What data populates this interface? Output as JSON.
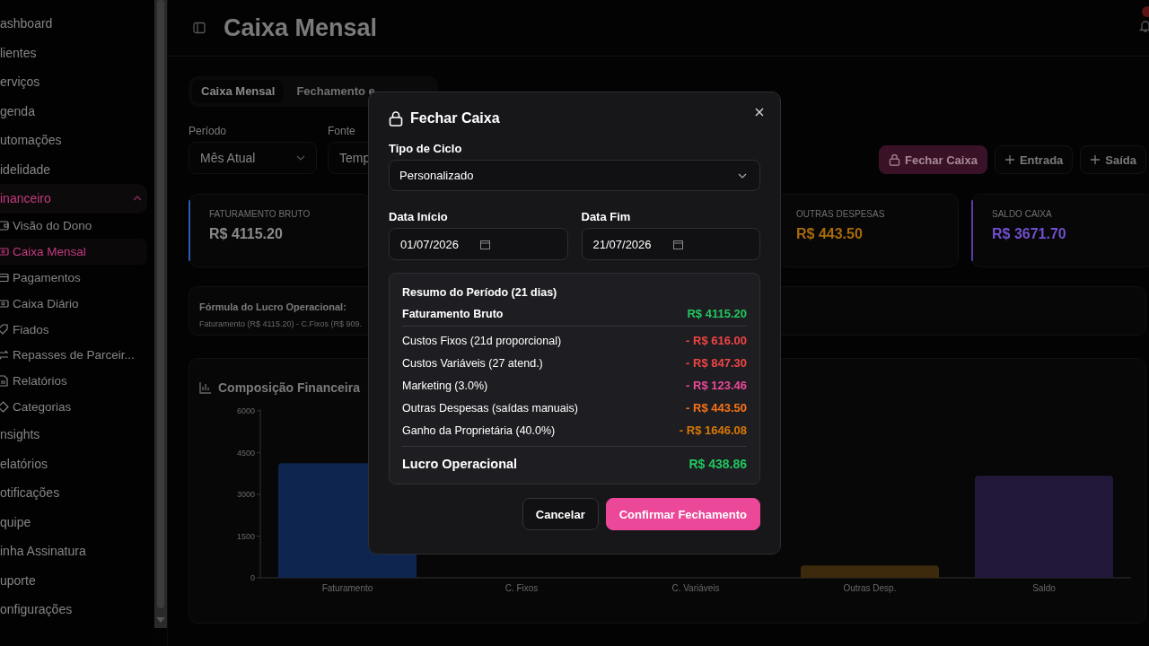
{
  "sidebar": {
    "items": [
      {
        "label": "ashboard",
        "selected": false
      },
      {
        "label": "lientes",
        "selected": false
      },
      {
        "label": "erviços",
        "selected": false
      },
      {
        "label": "genda",
        "selected": false
      },
      {
        "label": "utomações",
        "selected": false
      },
      {
        "label": "idelidade",
        "selected": false
      },
      {
        "label": "inanceiro",
        "selected": true,
        "expanded": true,
        "children": [
          {
            "label": "Visão do Dono",
            "selected": false
          },
          {
            "label": "Caixa Mensal",
            "selected": true
          },
          {
            "label": "Pagamentos",
            "selected": false
          },
          {
            "label": "Caixa Diário",
            "selected": false
          },
          {
            "label": "Fiados",
            "selected": false
          },
          {
            "label": "Repasses de Parceir...",
            "selected": false
          },
          {
            "label": "Relatórios",
            "selected": false
          },
          {
            "label": "Categorias",
            "selected": false
          }
        ]
      },
      {
        "label": "nsights",
        "selected": false
      },
      {
        "label": "elatórios",
        "selected": false
      },
      {
        "label": "otificações",
        "selected": false
      },
      {
        "label": "quipe",
        "selected": false
      },
      {
        "label": "inha Assinatura",
        "selected": false
      },
      {
        "label": "uporte",
        "selected": false
      },
      {
        "label": "onfigurações",
        "selected": false
      }
    ]
  },
  "header": {
    "title": "Caixa Mensal"
  },
  "tabs": [
    {
      "label": "Caixa Mensal",
      "selected": true
    },
    {
      "label": "Fechamento e",
      "selected": false
    }
  ],
  "filters": [
    {
      "label": "Período",
      "value": "Mês Atual",
      "arrow": true
    },
    {
      "label": "Fonte",
      "value": "Temp"
    }
  ],
  "actions": [
    {
      "label": "Fechar Caixa",
      "kind": "primary"
    },
    {
      "label": "Entrada",
      "kind": "outline"
    },
    {
      "label": "Saída",
      "kind": "outline"
    }
  ],
  "kpis": [
    {
      "label": "FATURAMENTO BRUTO",
      "value": "R$ 4115.20",
      "color": "#8a8a8a",
      "accent": {
        "color": "#2a5ab0"
      }
    },
    {
      "label": "OUTRAS DESPESAS",
      "value": "R$ 443.50",
      "color": "#a86a0c"
    },
    {
      "label": "SALDO CAIXA",
      "value": "R$ 3671.70",
      "color": "#7050cc",
      "accent": {
        "color": "#5a3ca8"
      }
    }
  ],
  "formula": {
    "title": "Fórmula do Lucro Operacional:",
    "text": "Faturamento (R$ 4115.20) - C.Fixos (R$ 909."
  },
  "chart": {
    "title": "Composição Financeira",
    "chart_data": {
      "type": "bar",
      "stacked": true,
      "categories": [
        "Faturamento",
        "C. Fixos",
        "C. Variáveis",
        "Outras Desp.",
        "Saldo"
      ],
      "series": [
        {
          "color": "#0e2550",
          "values": [
            4120,
            null,
            null,
            null,
            null
          ]
        },
        {
          "color": "#3d2a0c",
          "values": [
            null,
            null,
            null,
            440,
            null
          ]
        },
        {
          "color": "#22183a",
          "values": [
            null,
            null,
            null,
            null,
            3670
          ]
        }
      ],
      "ylim": [
        0,
        6000
      ],
      "yticks": [
        0,
        1500,
        3000,
        4500,
        6000
      ]
    }
  },
  "modal": {
    "title": "Fechar Caixa",
    "cycle": {
      "label": "Tipo de Ciclo",
      "value": "Personalizado"
    },
    "dates": [
      {
        "label": "Data Início",
        "value": "01/07/2026"
      },
      {
        "label": "Data Fim",
        "value": "21/07/2026"
      }
    ],
    "summary": {
      "title": "Resumo do Período (21 dias)",
      "rows": [
        {
          "kind": "header",
          "label": "Faturamento Bruto",
          "value": "R$ 4115.20",
          "color": "#22c55e"
        },
        {
          "kind": "item",
          "label": "Custos Fixos (21d proporcional)",
          "value": "- R$ 616.00",
          "color": "#ef4444"
        },
        {
          "kind": "item",
          "label": "Custos Variáveis (27 atend.)",
          "value": "- R$ 847.30",
          "color": "#ef4444"
        },
        {
          "kind": "item",
          "label": "Marketing (3.0%)",
          "value": "- R$ 123.46",
          "color": "#ec4899"
        },
        {
          "kind": "item",
          "label": "Outras Despesas (saídas manuais)",
          "value": "- R$ 443.50",
          "color": "#f97316"
        },
        {
          "kind": "item",
          "label": "Ganho da Proprietária (40.0%)",
          "value": "- R$ 1646.08",
          "color": "#d97706"
        },
        {
          "kind": "total",
          "label": "Lucro Operacional",
          "value": "R$ 438.86",
          "color": "#22c55e"
        }
      ]
    },
    "buttons": [
      {
        "label": "Cancelar",
        "kind": "secondary"
      },
      {
        "label": "Confirmar Fechamento",
        "kind": "primary"
      }
    ]
  }
}
